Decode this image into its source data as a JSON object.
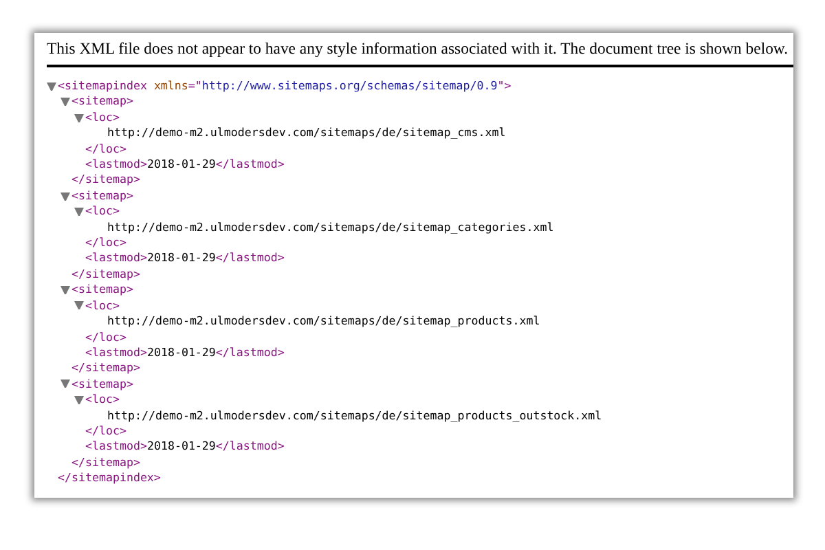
{
  "notice": "This XML file does not appear to have any style information associated with it. The document tree is shown below.",
  "tree": [
    {
      "kind": "node",
      "expanded": true,
      "open": [
        {
          "kind": "tag",
          "text": "<sitemapindex "
        },
        {
          "kind": "attribute-name",
          "text": "xmlns"
        },
        {
          "kind": "tag",
          "text": "=\""
        },
        {
          "kind": "attribute-value",
          "text": "http://www.sitemaps.org/schemas/sitemap/0.9"
        },
        {
          "kind": "tag",
          "text": "\">"
        }
      ],
      "close": "</sitemapindex>",
      "children": [
        {
          "kind": "node",
          "expanded": true,
          "open": [
            {
              "kind": "tag",
              "text": "<sitemap>"
            }
          ],
          "close": "</sitemap>",
          "children": [
            {
              "kind": "node",
              "expanded": true,
              "open": [
                {
                  "kind": "tag",
                  "text": "<loc>"
                }
              ],
              "close": "</loc>",
              "children": [
                {
                  "kind": "text",
                  "text": "http://demo-m2.ulmodersdev.com/sitemaps/de/sitemap_cms.xml"
                }
              ]
            },
            {
              "kind": "inline",
              "segments": [
                {
                  "kind": "tag",
                  "text": "<lastmod>"
                },
                {
                  "kind": "text",
                  "text": "2018-01-29"
                },
                {
                  "kind": "tag",
                  "text": "</lastmod>"
                }
              ]
            }
          ]
        },
        {
          "kind": "node",
          "expanded": true,
          "open": [
            {
              "kind": "tag",
              "text": "<sitemap>"
            }
          ],
          "close": "</sitemap>",
          "children": [
            {
              "kind": "node",
              "expanded": true,
              "open": [
                {
                  "kind": "tag",
                  "text": "<loc>"
                }
              ],
              "close": "</loc>",
              "children": [
                {
                  "kind": "text",
                  "text": "http://demo-m2.ulmodersdev.com/sitemaps/de/sitemap_categories.xml"
                }
              ]
            },
            {
              "kind": "inline",
              "segments": [
                {
                  "kind": "tag",
                  "text": "<lastmod>"
                },
                {
                  "kind": "text",
                  "text": "2018-01-29"
                },
                {
                  "kind": "tag",
                  "text": "</lastmod>"
                }
              ]
            }
          ]
        },
        {
          "kind": "node",
          "expanded": true,
          "open": [
            {
              "kind": "tag",
              "text": "<sitemap>"
            }
          ],
          "close": "</sitemap>",
          "children": [
            {
              "kind": "node",
              "expanded": true,
              "open": [
                {
                  "kind": "tag",
                  "text": "<loc>"
                }
              ],
              "close": "</loc>",
              "children": [
                {
                  "kind": "text",
                  "text": "http://demo-m2.ulmodersdev.com/sitemaps/de/sitemap_products.xml"
                }
              ]
            },
            {
              "kind": "inline",
              "segments": [
                {
                  "kind": "tag",
                  "text": "<lastmod>"
                },
                {
                  "kind": "text",
                  "text": "2018-01-29"
                },
                {
                  "kind": "tag",
                  "text": "</lastmod>"
                }
              ]
            }
          ]
        },
        {
          "kind": "node",
          "expanded": true,
          "open": [
            {
              "kind": "tag",
              "text": "<sitemap>"
            }
          ],
          "close": "</sitemap>",
          "children": [
            {
              "kind": "node",
              "expanded": true,
              "open": [
                {
                  "kind": "tag",
                  "text": "<loc>"
                }
              ],
              "close": "</loc>",
              "children": [
                {
                  "kind": "text",
                  "text": "http://demo-m2.ulmodersdev.com/sitemaps/de/sitemap_products_outstock.xml"
                }
              ]
            },
            {
              "kind": "inline",
              "segments": [
                {
                  "kind": "tag",
                  "text": "<lastmod>"
                },
                {
                  "kind": "text",
                  "text": "2018-01-29"
                },
                {
                  "kind": "tag",
                  "text": "</lastmod>"
                }
              ]
            }
          ]
        }
      ]
    }
  ]
}
